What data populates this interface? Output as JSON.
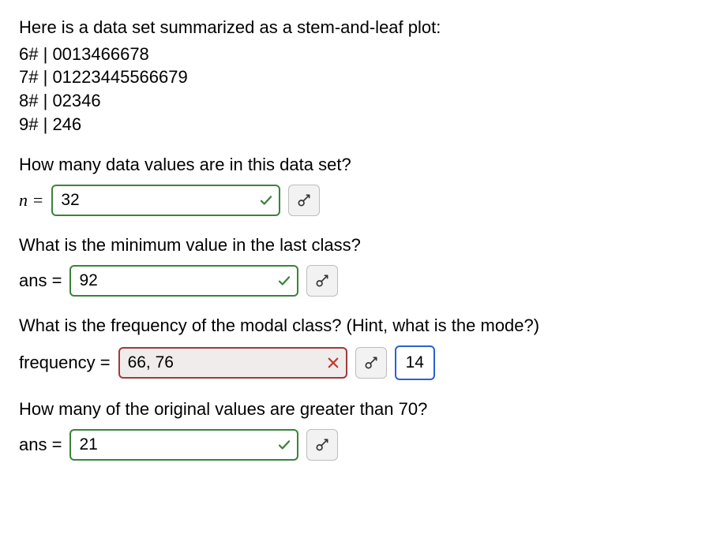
{
  "intro": "Here is a data set summarized as a stem-and-leaf plot:",
  "stems": [
    {
      "stem": "6#",
      "leaves": "0013466678"
    },
    {
      "stem": "7#",
      "leaves": "01223445566679"
    },
    {
      "stem": "8#",
      "leaves": "02346"
    },
    {
      "stem": "9#",
      "leaves": "246"
    }
  ],
  "q1": {
    "prompt": "How many data values are in this data set?",
    "label_html": "n =",
    "value": "32",
    "status": "correct"
  },
  "q2": {
    "prompt": "What is the minimum value in the last class?",
    "label": "ans =",
    "value": "92",
    "status": "correct"
  },
  "q3": {
    "prompt": "What is the frequency of the modal class? (Hint, what is the mode?)",
    "label": "frequency =",
    "value": "66, 76",
    "status": "wrong",
    "correct": "14"
  },
  "q4": {
    "prompt": "How many of the original values are greater than 70?",
    "label": "ans =",
    "value": "21",
    "status": "correct"
  }
}
